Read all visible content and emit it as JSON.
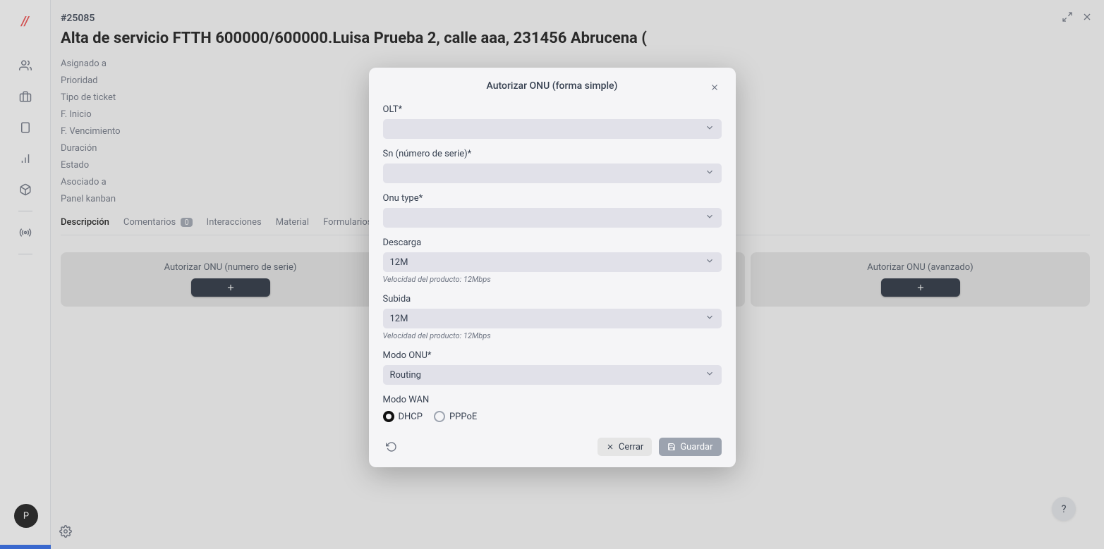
{
  "sidebar": {
    "logo": "//",
    "avatar_letter": "P"
  },
  "ticket": {
    "id": "#25085",
    "title": "Alta de servicio FTTH 600000/600000.Luisa Prueba 2, calle aaa, 231456 Abrucena (",
    "meta": {
      "assigned": "Asignado a",
      "priority": "Prioridad",
      "type": "Tipo de ticket",
      "start": "F. Inicio",
      "due": "F. Vencimiento",
      "duration": "Duración",
      "state": "Estado",
      "associated": "Asociado a",
      "kanban": "Panel kanban"
    }
  },
  "tabs": {
    "description": "Descripción",
    "comments": "Comentarios",
    "comments_count": "0",
    "interactions": "Interacciones",
    "material": "Material",
    "forms": "Formularios adic"
  },
  "cards": {
    "serial": "Autorizar ONU (numero de serie)",
    "advanced": "Autorizar ONU (avanzado)"
  },
  "modal": {
    "title": "Autorizar ONU (forma simple)",
    "olt_label": "OLT*",
    "sn_label": "Sn (número de serie)*",
    "onu_type_label": "Onu type*",
    "descarga_label": "Descarga",
    "descarga_value": "12M",
    "descarga_helper": "Velocidad del producto: 12Mbps",
    "subida_label": "Subida",
    "subida_value": "12M",
    "subida_helper": "Velocidad del producto: 12Mbps",
    "modo_onu_label": "Modo ONU*",
    "modo_onu_value": "Routing",
    "modo_wan_label": "Modo WAN",
    "wan_dhcp": "DHCP",
    "wan_pppoe": "PPPoE",
    "close_btn": "Cerrar",
    "save_btn": "Guardar"
  },
  "help": "?"
}
